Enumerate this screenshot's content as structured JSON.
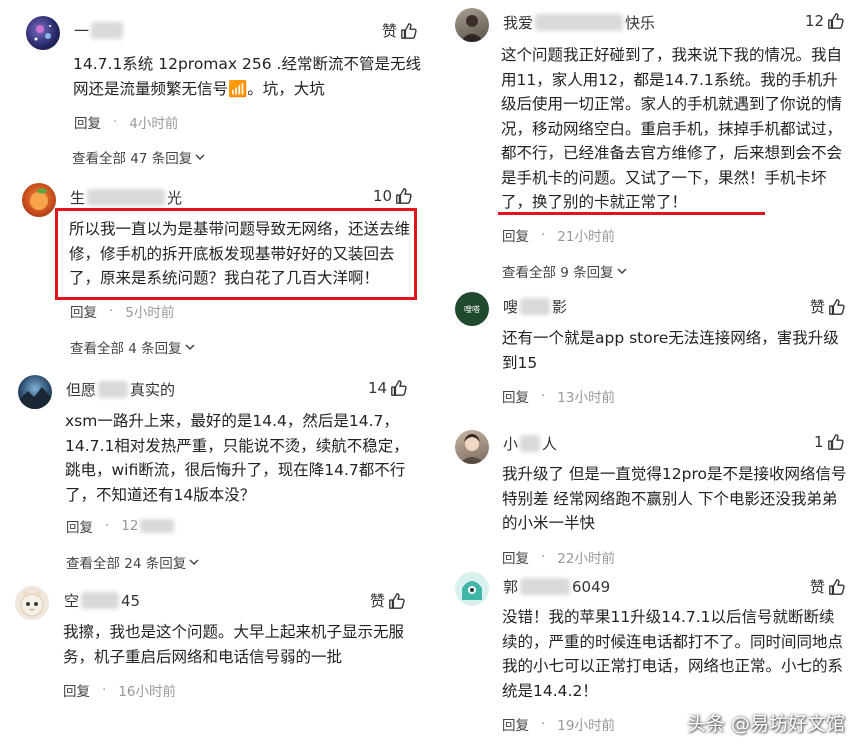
{
  "left": [
    {
      "user": {
        "prefix": "一",
        "suffix": ""
      },
      "likes": "赞",
      "text": "14.7.1系统 12promax 256 .经常断流不管是无线网还是流量频繁无信号📶。坑，大坑",
      "reply_label": "回复",
      "time": "4小时前",
      "view_all": "查看全部 47 条回复"
    },
    {
      "user": {
        "prefix": "生",
        "suffix": "光"
      },
      "likes": "10",
      "text": "所以我一直以为是基带问题导致无网络，还送去维修，修手机的拆开底板发现基带好好的又装回去了，原来是系统问题？我白花了几百大洋啊！",
      "reply_label": "回复",
      "time": "5小时前",
      "view_all": "查看全部 4 条回复"
    },
    {
      "user": {
        "prefix": "但愿",
        "suffix": "真实的"
      },
      "likes": "14",
      "text": "xsm一路升上来，最好的是14.4，然后是14.7，14.7.1相对发热严重，只能说不烫，续航不稳定，跳电，wifi断流，很后悔升了，现在降14.7都不行了，不知道还有14版本没？",
      "reply_label": "回复",
      "time": "12",
      "view_all": "查看全部 24 条回复"
    },
    {
      "user": {
        "prefix": "空",
        "suffix": "45"
      },
      "likes": "赞",
      "text": "我擦，我也是这个问题。大早上起来机子显示无服务，机子重启后网络和电话信号弱的一批",
      "reply_label": "回复",
      "time": "16小时前"
    }
  ],
  "right": [
    {
      "user": {
        "prefix": "我爱",
        "suffix": "快乐"
      },
      "likes": "12",
      "text": "这个问题我正好碰到了，我来说下我的情况。我自用11，家人用12，都是14.7.1系统。我的手机升级后使用一切正常。家人的手机就遇到了你说的情况，移动网络空白。重启手机，抹掉手机都试过，都不行，已经准备去官方维修了，后来想到会不会是手机卡的问题。又试了一下，果然！手机卡坏了，换了别的卡就正常了！",
      "reply_label": "回复",
      "time": "21小时前",
      "view_all": "查看全部 9 条回复"
    },
    {
      "user": {
        "prefix": "嗖",
        "suffix": "影"
      },
      "avatar_text": "嗖嗒",
      "likes": "赞",
      "text": "还有一个就是app store无法连接网络，害我升级到15",
      "reply_label": "回复",
      "time": "13小时前"
    },
    {
      "user": {
        "prefix": "小",
        "suffix": "人"
      },
      "likes": "1",
      "text": "我升级了 但是一直觉得12pro是不是接收网络信号特别差 经常网络跑不赢别人 下个电影还没我弟弟的小米一半快",
      "reply_label": "回复",
      "time": "22小时前"
    },
    {
      "user": {
        "prefix": "郭",
        "suffix": "6049"
      },
      "likes": "赞",
      "text": "没错！我的苹果11升级14.7.1以后信号就断断续续的，严重的时候连电话都打不了。同时间同地点我的小七可以正常打电话，网络也正常。小七的系统是14.4.2！",
      "reply_label": "回复",
      "time": "19小时前"
    }
  ],
  "watermark": "头条 @易坊好文馆",
  "colors": {
    "highlight_red": "#e1141e",
    "time_gray": "#999999",
    "text": "#222222"
  }
}
